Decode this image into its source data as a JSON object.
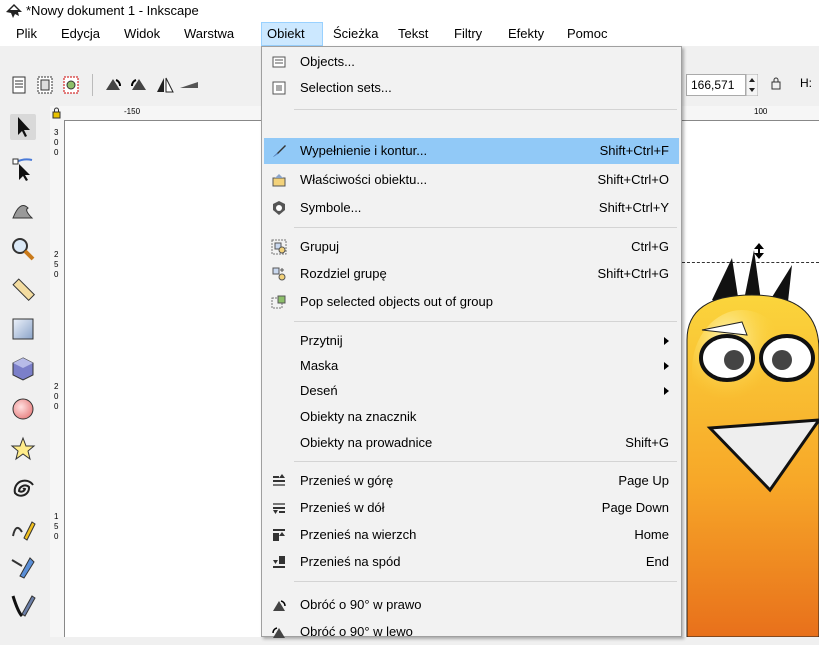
{
  "window": {
    "title": "*Nowy dokument 1 - Inkscape"
  },
  "menubar": [
    {
      "label": "Plik",
      "u": "P"
    },
    {
      "label": "Edycja",
      "u": "E"
    },
    {
      "label": "Widok",
      "u": "W"
    },
    {
      "label": "Warstwa",
      "u": "a"
    },
    {
      "label": "Obiekt",
      "u": "O"
    },
    {
      "label": "Ścieżka",
      "u": "Ś"
    },
    {
      "label": "Tekst",
      "u": "T"
    },
    {
      "label": "Filtry",
      "u": "F"
    },
    {
      "label": "Efekty",
      "u": "k"
    },
    {
      "label": "Pomoc",
      "u": "m"
    }
  ],
  "toolbar": {
    "coord_value": "166,571",
    "h_label": "H:"
  },
  "rulers": {
    "h_ticks": [
      "-150",
      "100"
    ],
    "v_ticks": [
      "3",
      "0",
      "0",
      "2",
      "5",
      "0",
      "2",
      "0",
      "0",
      "1",
      "5",
      "0"
    ]
  },
  "menu": {
    "items": [
      {
        "label": "Objects...",
        "shortcut": "",
        "icon": "objects-icon"
      },
      {
        "label": "Selection sets...",
        "shortcut": "",
        "icon": "selection-sets-icon"
      },
      {
        "label": "Wypełnienie i kontur...",
        "shortcut": "Shift+Ctrl+F",
        "icon": "fill-stroke-icon"
      },
      {
        "label": "Właściwości obiektu...",
        "shortcut": "Shift+Ctrl+O",
        "icon": "object-properties-icon"
      },
      {
        "label": "Symbole...",
        "shortcut": "Shift+Ctrl+Y",
        "icon": "symbols-icon"
      },
      {
        "label": "Grupuj",
        "shortcut": "Ctrl+G",
        "icon": "group-icon"
      },
      {
        "label": "Rozdziel grupę",
        "shortcut": "Shift+Ctrl+G",
        "icon": "ungroup-icon"
      },
      {
        "label": "Pop selected objects out of group",
        "shortcut": "",
        "icon": "pop-out-icon"
      },
      {
        "label": "Przytnij",
        "shortcut": "",
        "icon": ""
      },
      {
        "label": "Maska",
        "shortcut": "",
        "icon": ""
      },
      {
        "label": "Deseń",
        "shortcut": "",
        "icon": ""
      },
      {
        "label": "Obiekty na znacznik",
        "shortcut": "",
        "icon": ""
      },
      {
        "label": "Obiekty na prowadnice",
        "shortcut": "Shift+G",
        "icon": ""
      },
      {
        "label": "Przenieś w górę",
        "shortcut": "Page Up",
        "icon": "raise-icon"
      },
      {
        "label": "Przenieś w dół",
        "shortcut": "Page Down",
        "icon": "lower-icon"
      },
      {
        "label": "Przenieś na wierzch",
        "shortcut": "Home",
        "icon": "raise-to-top-icon"
      },
      {
        "label": "Przenieś na spód",
        "shortcut": "End",
        "icon": "lower-to-bottom-icon"
      },
      {
        "label": "Obróć o 90° w prawo",
        "shortcut": "",
        "icon": "rotate-cw-icon"
      },
      {
        "label": "Obróć o 90° w lewo",
        "shortcut": "",
        "icon": "rotate-ccw-icon"
      }
    ]
  },
  "colors": {
    "highlight": "#91c9f7",
    "menu_active": "#cce8ff",
    "bird_yellow": "#f7c31c",
    "bird_orange": "#f08a1c"
  }
}
